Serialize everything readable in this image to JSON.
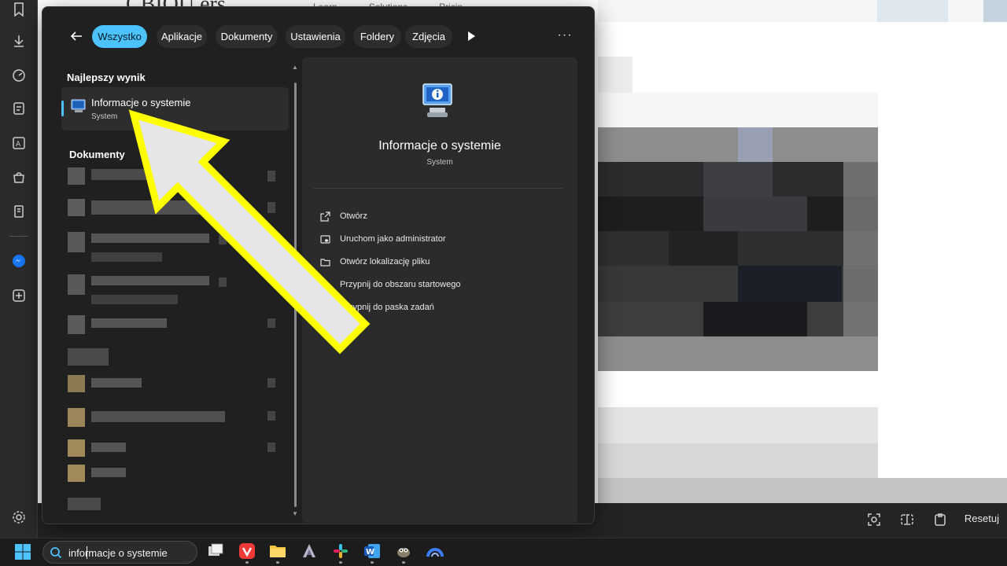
{
  "background": {
    "logo_text": "CBIOU  ers",
    "nav_items": [
      "Learn",
      "Solutions",
      "Pricin"
    ]
  },
  "edge_sidebar": {
    "icons": [
      "bookmark-icon",
      "download-icon",
      "performance-icon",
      "notes-icon",
      "translate-icon",
      "shopping-icon",
      "reading-icon",
      "messenger-icon",
      "add-icon",
      "settings-icon"
    ]
  },
  "search_panel": {
    "filters": [
      {
        "label": "Wszystko",
        "active": true
      },
      {
        "label": "Aplikacje",
        "active": false
      },
      {
        "label": "Dokumenty",
        "active": false
      },
      {
        "label": "Ustawienia",
        "active": false
      },
      {
        "label": "Foldery",
        "active": false
      },
      {
        "label": "Zdjęcia",
        "active": false
      }
    ],
    "best_match_title": "Najlepszy wynik",
    "best_match": {
      "name": "Informacje o systemie",
      "type": "System"
    },
    "documents_title": "Dokumenty",
    "detail": {
      "title": "Informacje o systemie",
      "subtitle": "System",
      "actions": [
        {
          "label": "Otwórz",
          "icon": "open-external-icon"
        },
        {
          "label": "Uruchom jako administrator",
          "icon": "shield-admin-icon"
        },
        {
          "label": "Otwórz lokalizację pliku",
          "icon": "folder-icon"
        },
        {
          "label": "Przypnij do obszaru startowego",
          "icon": "pin-icon"
        },
        {
          "label": "Przypnij do paska zadań",
          "icon": "pin-taskbar-icon"
        }
      ]
    }
  },
  "browser_bottom": {
    "reset_label": "Resetuj"
  },
  "taskbar": {
    "search_value": "informacje o systemie",
    "apps": [
      "task-view-icon",
      "vivaldi-icon",
      "file-explorer-icon",
      "app-a-icon",
      "slack-icon",
      "word-icon",
      "gimp-icon",
      "app-arc-icon"
    ]
  },
  "colors": {
    "accent": "#4cc2ff",
    "panel_bg": "#202020",
    "arrow_fill": "#e6e6e6",
    "arrow_border": "#ffff00"
  }
}
